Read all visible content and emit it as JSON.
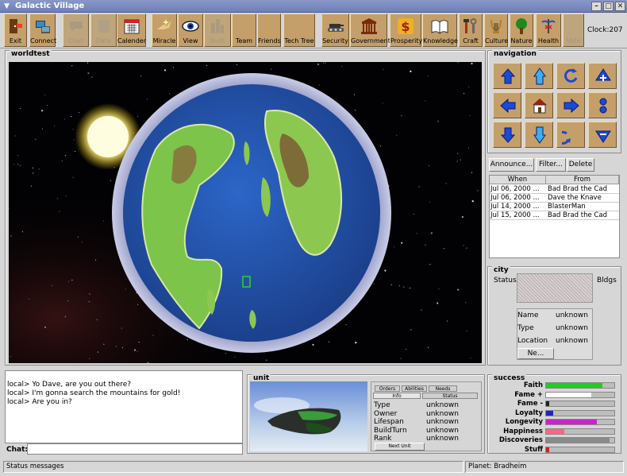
{
  "window": {
    "title": "Galactic Village"
  },
  "toolbar": {
    "buttons": [
      {
        "label": "Exit",
        "icon": "exit-icon",
        "enabled": true
      },
      {
        "label": "Connect",
        "icon": "connect-icon",
        "enabled": true
      },
      {
        "label": "Chat",
        "icon": "chat-icon",
        "enabled": false
      },
      {
        "label": "Data",
        "icon": "data-icon",
        "enabled": false
      },
      {
        "label": "Calender",
        "icon": "calendar-icon",
        "enabled": true
      },
      {
        "label": "Miracle",
        "icon": "miracle-icon",
        "enabled": true
      },
      {
        "label": "View",
        "icon": "eye-icon",
        "enabled": true
      },
      {
        "label": "Built",
        "icon": "buildings-icon",
        "enabled": false
      },
      {
        "label": "Team",
        "icon": "team-icon",
        "enabled": true
      },
      {
        "label": "Friends",
        "icon": "friends-icon",
        "enabled": true
      },
      {
        "label": "Tech Tree",
        "icon": "tech-tree-icon",
        "enabled": true
      },
      {
        "label": "Security",
        "icon": "tank-icon",
        "enabled": true
      },
      {
        "label": "Government",
        "icon": "capitol-icon",
        "enabled": true
      },
      {
        "label": "Prosperity",
        "icon": "dollar-icon",
        "enabled": true
      },
      {
        "label": "Knowledge",
        "icon": "book-icon",
        "enabled": true
      },
      {
        "label": "Craft",
        "icon": "tools-icon",
        "enabled": true
      },
      {
        "label": "Culture",
        "icon": "lyre-icon",
        "enabled": true
      },
      {
        "label": "Nature",
        "icon": "tree-icon",
        "enabled": true
      },
      {
        "label": "Health",
        "icon": "caduceus-icon",
        "enabled": true
      },
      {
        "label": "Vote",
        "icon": "blank-icon",
        "enabled": false
      }
    ],
    "clock": "Clock:207"
  },
  "world": {
    "title": "worldtest"
  },
  "navigation": {
    "title": "navigation",
    "buttons": [
      {
        "name": "nav-up-button",
        "icon": "arrow-up-icon"
      },
      {
        "name": "nav-tilt-up-button",
        "icon": "arrow-tilt-up-icon"
      },
      {
        "name": "nav-rotate-left-button",
        "icon": "rotate-ccw-icon"
      },
      {
        "name": "nav-zoom-in-button",
        "icon": "zoom-in-icon"
      },
      {
        "name": "nav-left-button",
        "icon": "arrow-left-icon"
      },
      {
        "name": "nav-home-button",
        "icon": "home-icon"
      },
      {
        "name": "nav-right-button",
        "icon": "arrow-right-icon"
      },
      {
        "name": "nav-reset-button",
        "icon": "dots-icon"
      },
      {
        "name": "nav-down-button",
        "icon": "arrow-down-icon"
      },
      {
        "name": "nav-tilt-down-button",
        "icon": "arrow-tilt-down-icon"
      },
      {
        "name": "nav-rotate-right-button",
        "icon": "rotate-cw-icon"
      },
      {
        "name": "nav-zoom-out-button",
        "icon": "zoom-out-icon"
      }
    ]
  },
  "messages": {
    "announce_label": "Announce...",
    "filter_label": "Filter...",
    "delete_label": "Delete",
    "columns": [
      "When",
      "From"
    ],
    "rows": [
      {
        "when": "Jul 06, 2000 ...",
        "from": "Bad Brad the Cad"
      },
      {
        "when": "Jul 06, 2000 ...",
        "from": "Dave the Knave"
      },
      {
        "when": "Jul 14, 2000 ...",
        "from": "BlasterMan"
      },
      {
        "when": "Jul 15, 2000 ...",
        "from": "Bad Brad the Cad"
      }
    ]
  },
  "city": {
    "title": "city",
    "status_label": "Status",
    "bldgs_label": "Bldgs",
    "name_label": "Name",
    "name_value": "unknown",
    "type_label": "Type",
    "type_value": "unknown",
    "location_label": "Location",
    "location_value": "unknown",
    "new_button": "Ne..."
  },
  "chat": {
    "lines": [
      "local> Yo Dave, are you out there?",
      "local> I'm gonna search the mountains for gold!",
      "local> Are you in?"
    ],
    "input_label": "Chat:",
    "input_value": ""
  },
  "unit": {
    "title": "unit",
    "tabs_top": [
      "Orders",
      "Abilities",
      "Needs"
    ],
    "tabs_bottom": [
      "Info",
      "Status"
    ],
    "fields": [
      {
        "label": "Type",
        "value": "unknown"
      },
      {
        "label": "Owner",
        "value": "unknown"
      },
      {
        "label": "Lifespan",
        "value": "unknown"
      },
      {
        "label": "BuildTurn",
        "value": "unknown"
      },
      {
        "label": "Rank",
        "value": "unknown"
      }
    ],
    "next_button": "Next Unit"
  },
  "success": {
    "title": "success",
    "metrics": [
      {
        "label": "Faith",
        "value": 0.82,
        "color": "#22cc22"
      },
      {
        "label": "Fame +",
        "value": 0.66,
        "color": "#ffffff"
      },
      {
        "label": "Fame -",
        "value": 0.05,
        "color": "#222222"
      },
      {
        "label": "Loyalty",
        "value": 0.1,
        "color": "#2222cc"
      },
      {
        "label": "Longevity",
        "value": 0.74,
        "color": "#cc22cc"
      },
      {
        "label": "Happiness",
        "value": 0.27,
        "color": "#ff6680"
      },
      {
        "label": "Discoveries",
        "value": 0.93,
        "color": "#8a8a8a"
      },
      {
        "label": "Stuff",
        "value": 0.05,
        "color": "#cc2222"
      }
    ]
  },
  "status": {
    "message": "Status messages",
    "planet": "Planet: Bradheim"
  }
}
